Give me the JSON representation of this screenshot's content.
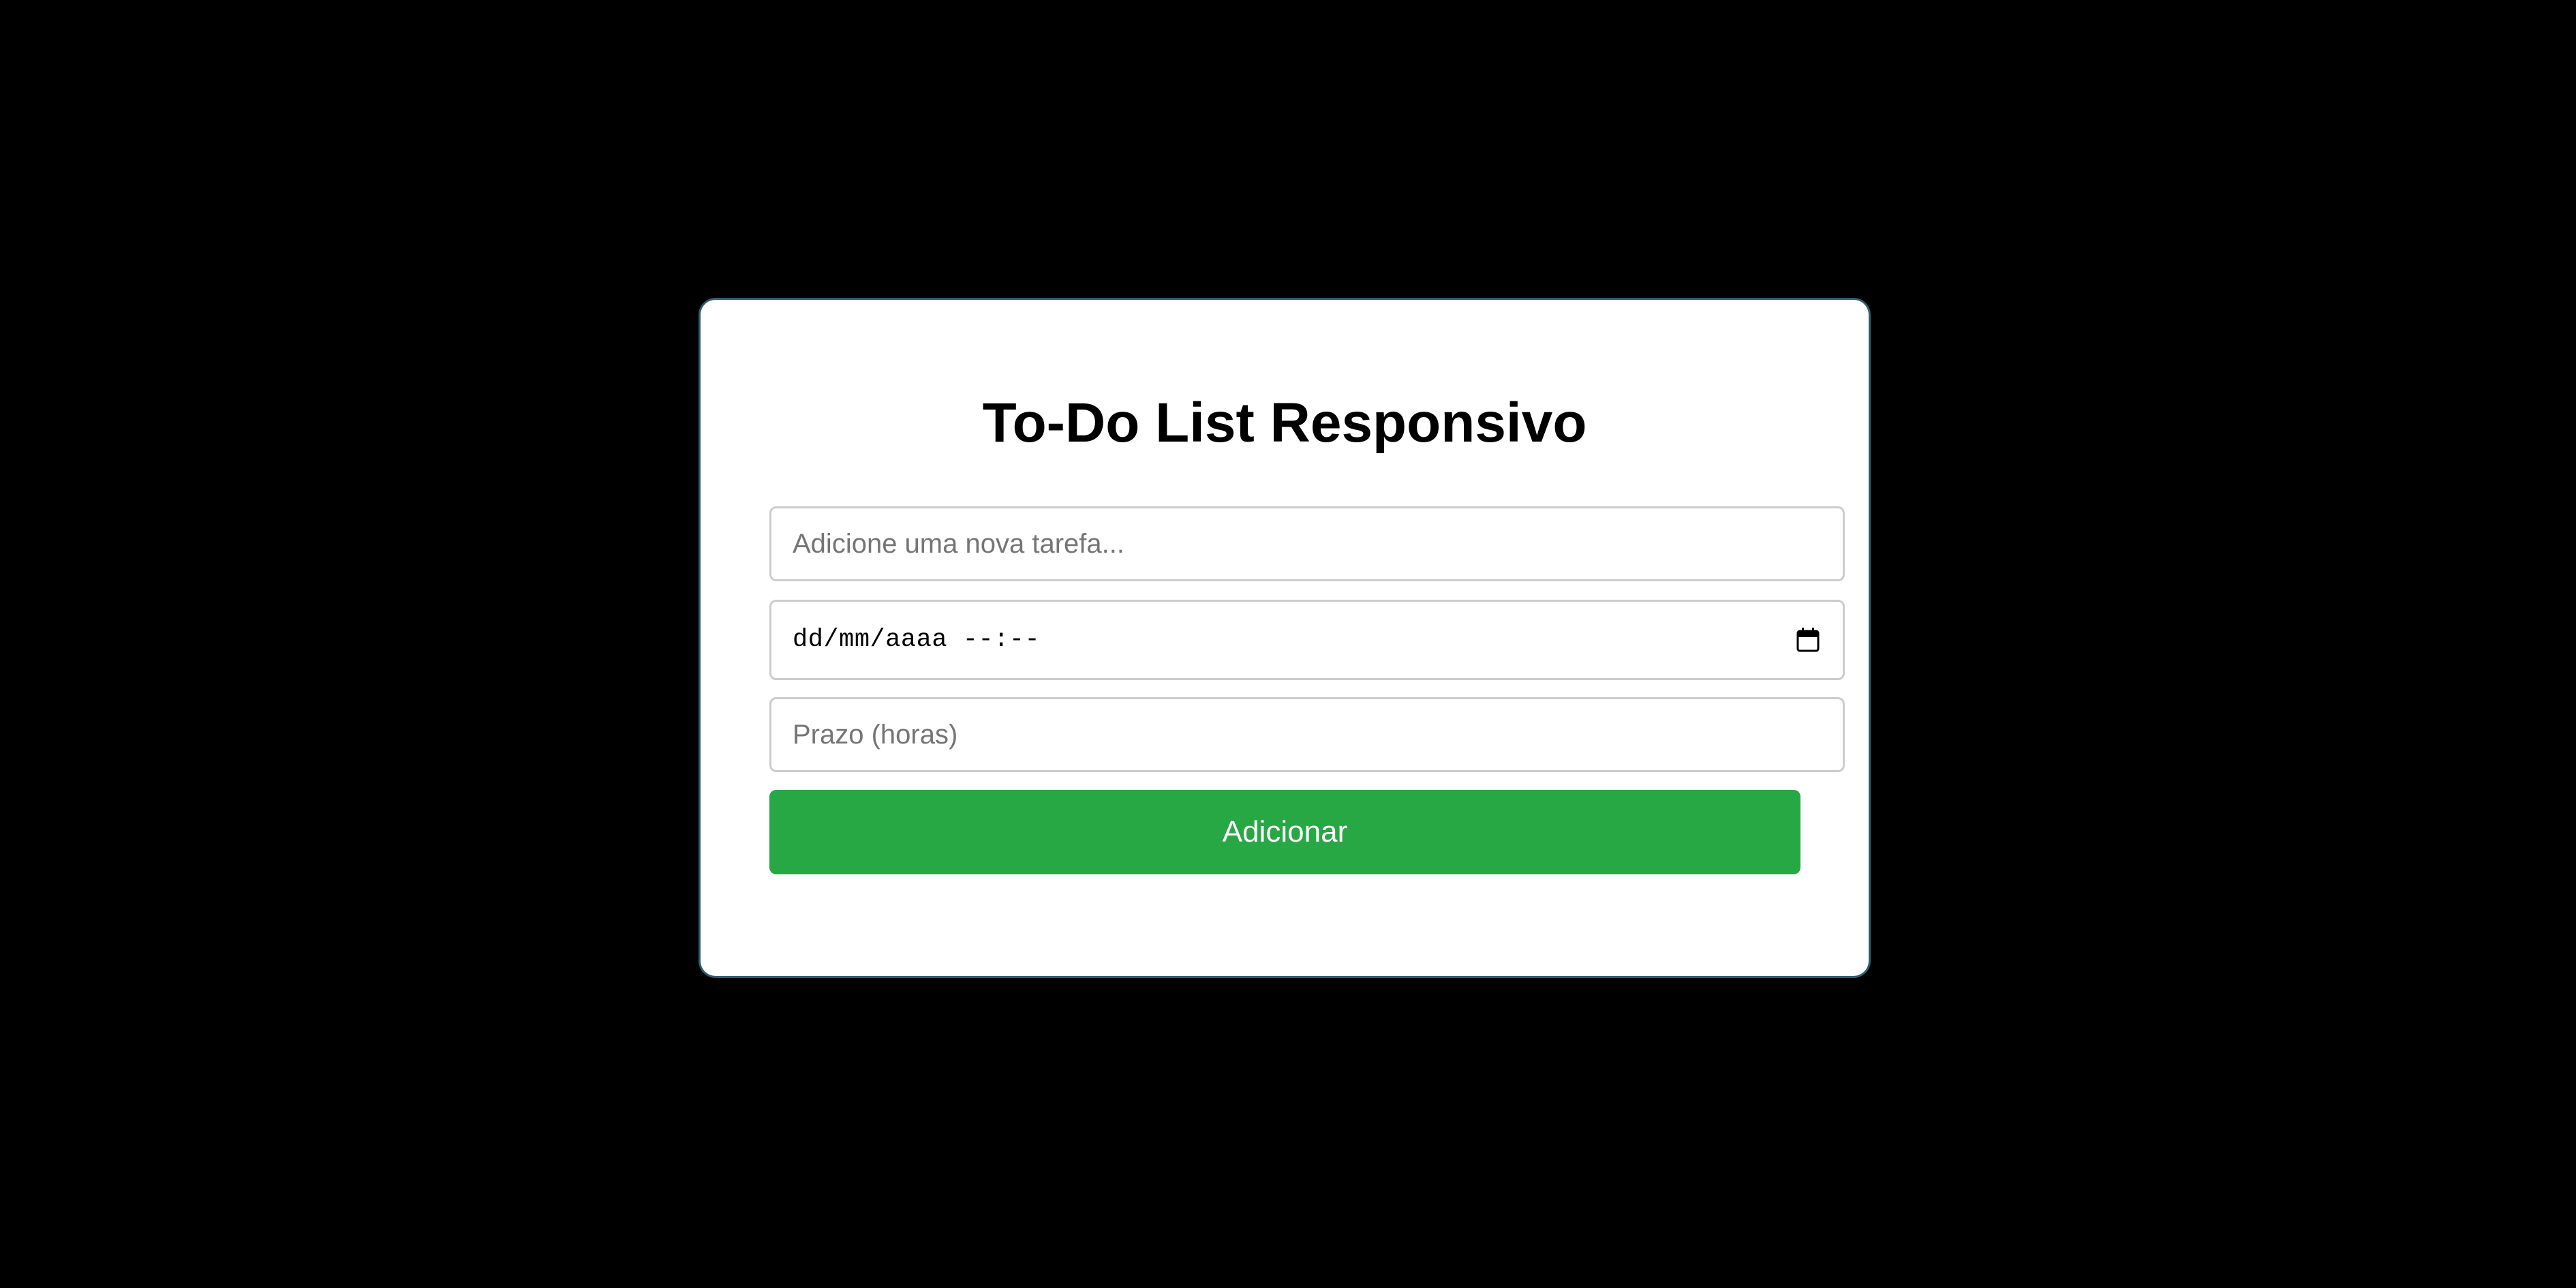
{
  "page": {
    "background_color": "#000000"
  },
  "card": {
    "title": "To-Do List Responsivo",
    "task_input": {
      "placeholder": "Adicione uma nova tarefa...",
      "value": ""
    },
    "datetime_input": {
      "display": "dd/mm/aaaa --:--",
      "icon": "calendar-icon"
    },
    "hours_input": {
      "placeholder": "Prazo (horas)",
      "value": ""
    },
    "add_button": {
      "label": "Adicionar",
      "color": "#28a745"
    }
  }
}
